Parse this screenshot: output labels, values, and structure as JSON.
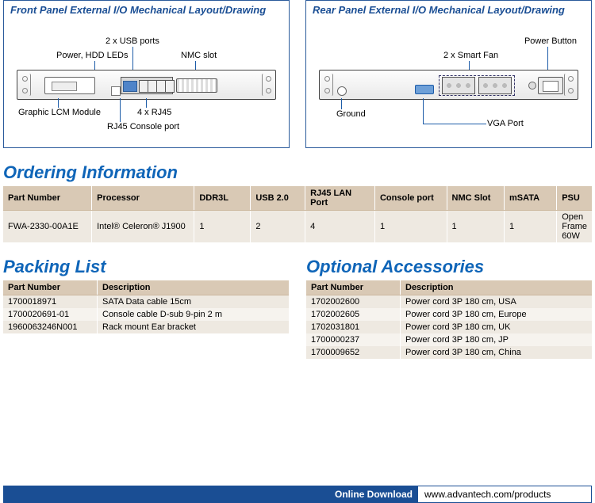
{
  "front_panel": {
    "title": "Front Panel External I/O Mechanical Layout/Drawing",
    "labels": {
      "usb": "2 x USB ports",
      "power_leds": "Power, HDD LEDs",
      "nmc": "NMC slot",
      "lcm": "Graphic LCM Module",
      "rj45": "4 x RJ45",
      "console": "RJ45 Console port"
    }
  },
  "rear_panel": {
    "title": "Rear Panel External I/O Mechanical Layout/Drawing",
    "labels": {
      "power_button": "Power Button",
      "smart_fan": "2 x Smart Fan",
      "ground": "Ground",
      "vga": "VGA Port"
    }
  },
  "ordering": {
    "heading": "Ordering Information",
    "columns": [
      "Part Number",
      "Processor",
      "DDR3L",
      "USB 2.0",
      "RJ45 LAN Port",
      "Console port",
      "NMC Slot",
      "mSATA",
      "PSU"
    ],
    "rows": [
      {
        "part": "FWA-2330-00A1E",
        "proc": "Intel® Celeron® J1900",
        "ddr3l": "1",
        "usb": "2",
        "lan": "4",
        "console": "1",
        "nmc": "1",
        "msata": "1",
        "psu": "Open Frame 60W"
      }
    ]
  },
  "packing": {
    "heading": "Packing List",
    "columns": [
      "Part Number",
      "Description"
    ],
    "rows": [
      {
        "part": "1700018971",
        "desc": "SATA Data cable 15cm"
      },
      {
        "part": "1700020691-01",
        "desc": "Console cable D-sub 9-pin 2 m"
      },
      {
        "part": "1960063246N001",
        "desc": "Rack mount Ear bracket"
      }
    ]
  },
  "accessories": {
    "heading": "Optional Accessories",
    "columns": [
      "Part Number",
      "Description"
    ],
    "rows": [
      {
        "part": "1702002600",
        "desc": "Power cord 3P 180 cm, USA"
      },
      {
        "part": "1702002605",
        "desc": "Power cord 3P 180 cm, Europe"
      },
      {
        "part": "1702031801",
        "desc": "Power cord 3P 180 cm, UK"
      },
      {
        "part": "1700000237",
        "desc": "Power cord 3P 180 cm, JP"
      },
      {
        "part": "1700009652",
        "desc": "Power cord 3P 180 cm, China"
      }
    ]
  },
  "footer": {
    "label": "Online Download",
    "url": "www.advantech.com/products"
  }
}
